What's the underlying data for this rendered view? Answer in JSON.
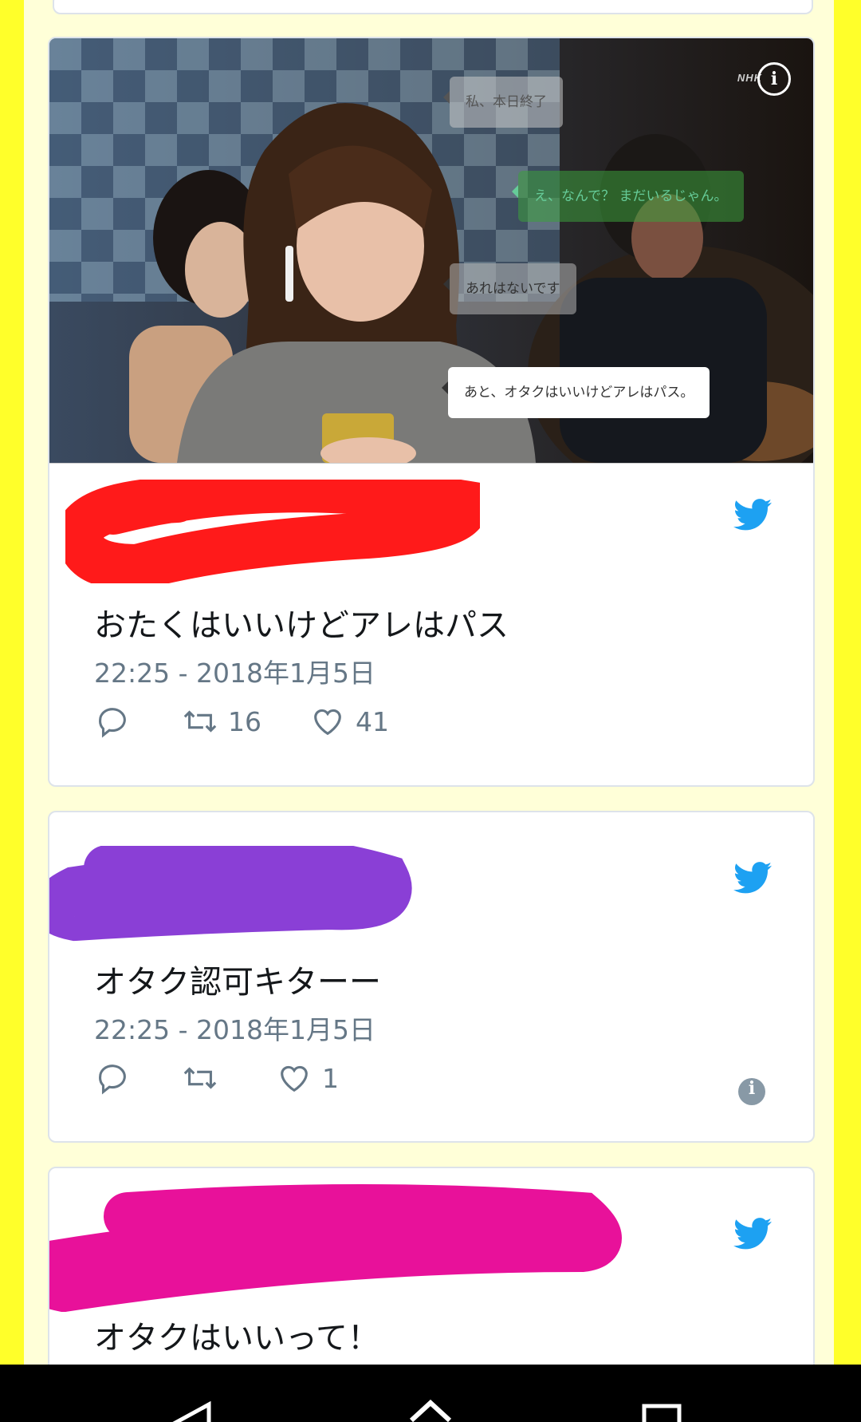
{
  "colors": {
    "page_bg": "#ffff2a",
    "column_bg": "#ffffd8",
    "twitter_blue": "#1da1f2",
    "muted": "#657786",
    "scribble_red": "#ff1a1a",
    "scribble_purple": "#8a3fd6",
    "scribble_pink": "#e8119a"
  },
  "media": {
    "watermark": "NHK",
    "info_glyph": "i",
    "bubbles": [
      "私、本日終了",
      "え、なんで？ まだいるじゃん。",
      "あれはないです",
      "あと、オタクはいいけどアレはパス。"
    ]
  },
  "tweets": [
    {
      "text": "おたくはいいけどアレはパス",
      "time": "22:25 - 2018年1月5日",
      "reply_icon": "reply-icon",
      "retweet_count": "16",
      "like_count": "41"
    },
    {
      "text": "オタク認可キターー",
      "time": "22:25 - 2018年1月5日",
      "reply_icon": "reply-icon",
      "retweet_count": "",
      "like_count": "1",
      "info_glyph": "i"
    },
    {
      "text": "オタクはいいって！"
    }
  ],
  "navbar": {
    "buttons": [
      "back-icon",
      "home-icon",
      "recents-icon"
    ]
  }
}
